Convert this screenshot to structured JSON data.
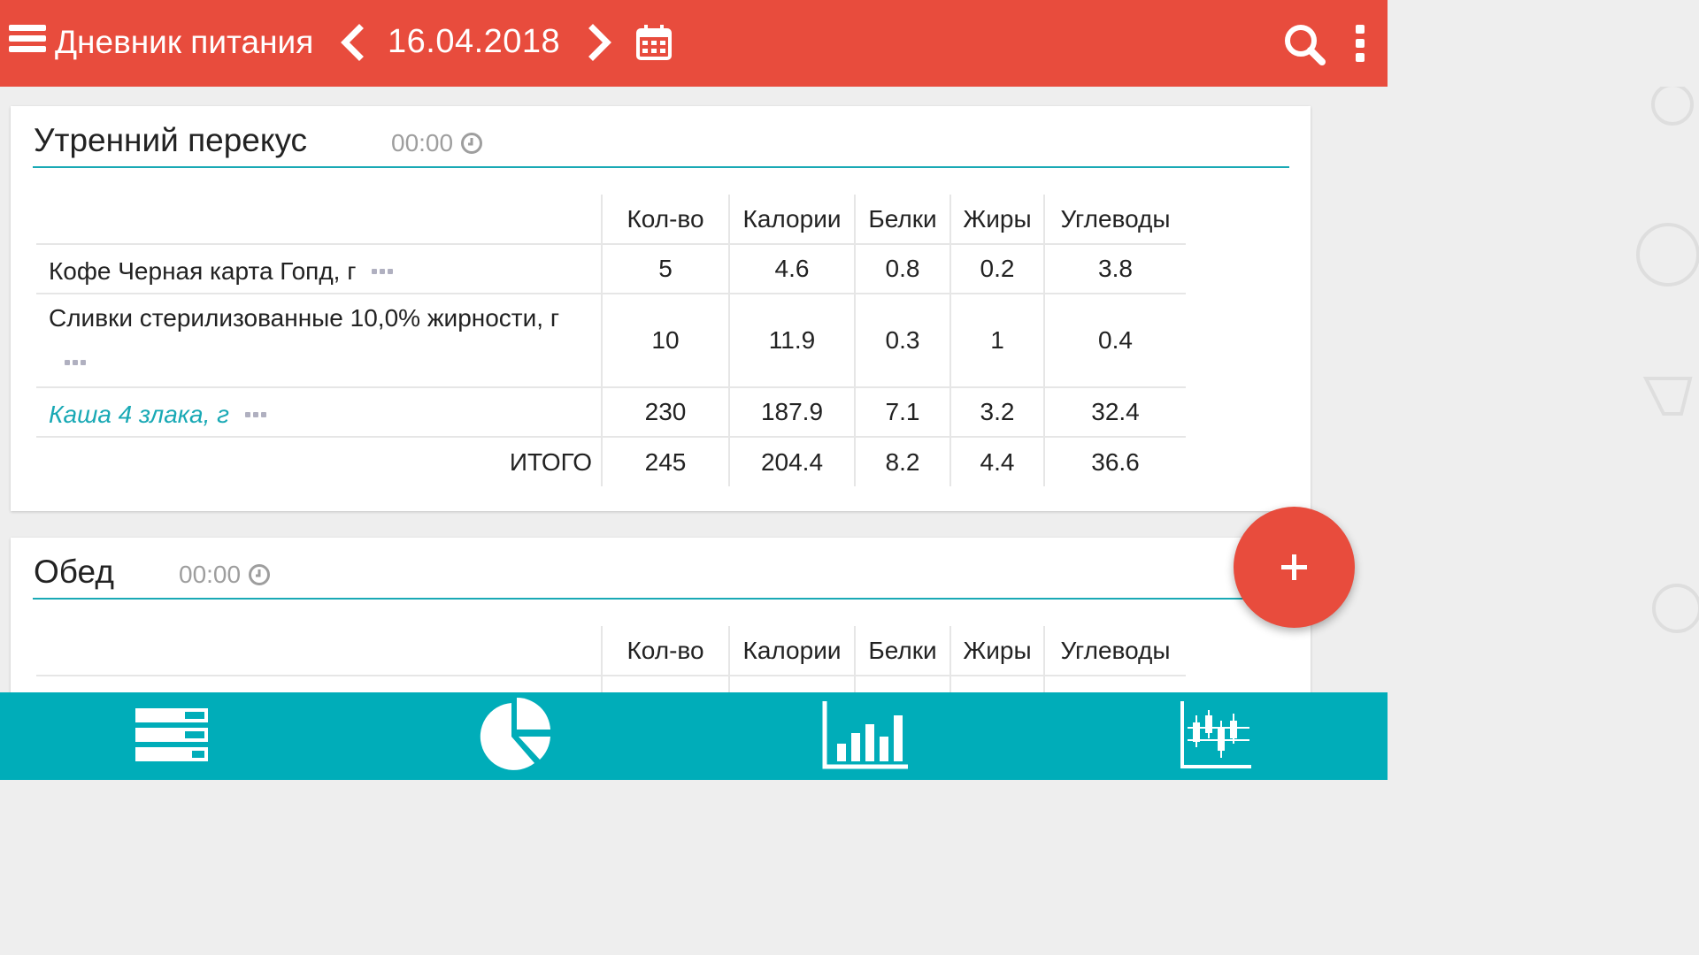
{
  "header": {
    "menu_icon": "hamburger-menu-icon",
    "title": "Дневник питания",
    "prev_icon": "chevron-left-icon",
    "date": "16.04.2018",
    "next_icon": "chevron-right-icon",
    "calendar_icon": "calendar-icon",
    "search_icon": "search-icon",
    "more_icon": "more-vertical-icon",
    "color": "#e84c3d"
  },
  "columns": [
    "Кол-во",
    "Калории",
    "Белки",
    "Жиры",
    "Углеводы"
  ],
  "meals": [
    {
      "title": "Утренний перекус",
      "time": "00:00",
      "items": [
        {
          "name": "Кофе Черная карта Гопд, г",
          "qty": "5",
          "kcal": "4.6",
          "protein": "0.8",
          "fat": "0.2",
          "carbs": "3.8",
          "style": "normal"
        },
        {
          "name": "Сливки стерилизованные 10,0% жирности, г",
          "qty": "10",
          "kcal": "11.9",
          "protein": "0.3",
          "fat": "1",
          "carbs": "0.4",
          "style": "normal"
        },
        {
          "name": "Каша 4 злака, г",
          "qty": "230",
          "kcal": "187.9",
          "protein": "7.1",
          "fat": "3.2",
          "carbs": "32.4",
          "style": "link"
        }
      ],
      "total": {
        "label": "ИТОГО",
        "qty": "245",
        "kcal": "204.4",
        "protein": "8.2",
        "fat": "4.4",
        "carbs": "36.6"
      }
    },
    {
      "title": "Обед",
      "time": "00:00"
    }
  ],
  "fab": {
    "icon": "plus-icon",
    "color": "#e84c3d"
  },
  "bottom_nav": {
    "color": "#00adb9",
    "tabs": [
      {
        "icon": "diary-list-icon"
      },
      {
        "icon": "pie-chart-icon"
      },
      {
        "icon": "bar-chart-icon"
      },
      {
        "icon": "candlestick-chart-icon"
      }
    ]
  },
  "accent_color": "#19a9b5"
}
